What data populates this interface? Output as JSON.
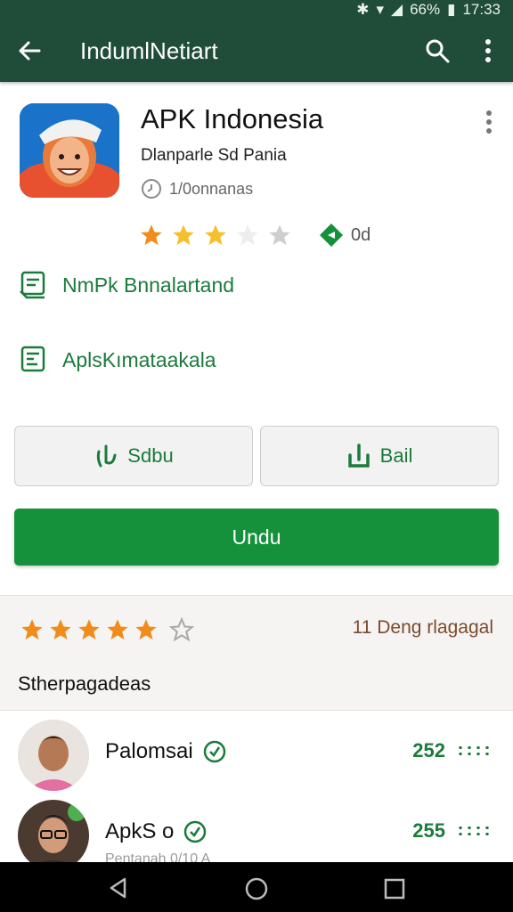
{
  "status_bar": {
    "battery": "66%",
    "time": "17:33"
  },
  "app_bar": {
    "title": "IndumlNetiart"
  },
  "app": {
    "name": "APK Indonesia",
    "developer": "Dlanparle Sd Pania",
    "meta": "1/0onnanas",
    "rating_text": "0d",
    "stars_filled": 3
  },
  "info_lines": [
    "NmPk Bnnalartand",
    "AplsKımataakala"
  ],
  "buttons": {
    "left": "Sdbu",
    "right": "Bail",
    "main": "Undu"
  },
  "reviews": {
    "stars_filled": 5,
    "count_text": "11 Deng rlagagal",
    "heading": "Stherpagadeas"
  },
  "users": [
    {
      "name": "Palomsai",
      "score": "252"
    },
    {
      "name": "ApkS o",
      "score": "255"
    }
  ],
  "faded_text": "Pentanah 0/10 A",
  "colors": {
    "primary": "#1f4d3a",
    "accent": "#15913c",
    "star": "#f29a1a"
  }
}
